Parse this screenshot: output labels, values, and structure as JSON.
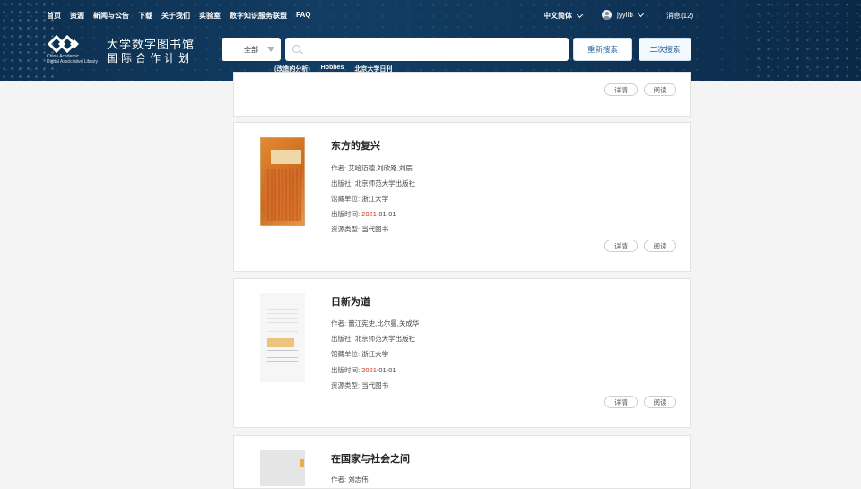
{
  "topnav": [
    "首页",
    "资源",
    "新闻与公告",
    "下载",
    "关于我们",
    "实验室",
    "数字知识服务联盟",
    "FAQ"
  ],
  "lang": "中文简体",
  "username": "jyylib",
  "messages": "消息(12)",
  "logo": {
    "title": "大学数字图书馆",
    "subtitle": "国际合作计划",
    "en_line1": "China Academic",
    "en_line2": "Digital Associative Library"
  },
  "search": {
    "scope": "全部",
    "value": "",
    "research_btn": "重新搜索",
    "second_btn": "二次搜索"
  },
  "hot_keywords": [
    "(改造的分析)",
    "Hobbes",
    "北京大学日刊"
  ],
  "labels": {
    "author": "作者:",
    "publisher": "出版社:",
    "holder": "馆藏单位:",
    "pubtime": "出版时间:",
    "restype": "资源类型:",
    "detail": "详情",
    "read": "阅读"
  },
  "books": [
    {
      "title": "东方的复兴",
      "author": "艾哈迈德,刘欣路,刘辰",
      "publisher": "北京师范大学出版社",
      "holder": "浙江大学",
      "year": "2021",
      "date_rest": "-01-01",
      "type": "当代图书"
    },
    {
      "title": "日新为道",
      "author": "蕾江宪史,比尔曼,关成华",
      "publisher": "北京师范大学出版社",
      "holder": "浙江大学",
      "year": "2021",
      "date_rest": "-01-01",
      "type": "当代图书"
    },
    {
      "title": "在国家与社会之间",
      "author": "刘志伟"
    }
  ],
  "colors": {
    "header_bg": "#123d63",
    "accent_blue": "#1f5f9a",
    "date_red": "#d0301f"
  }
}
